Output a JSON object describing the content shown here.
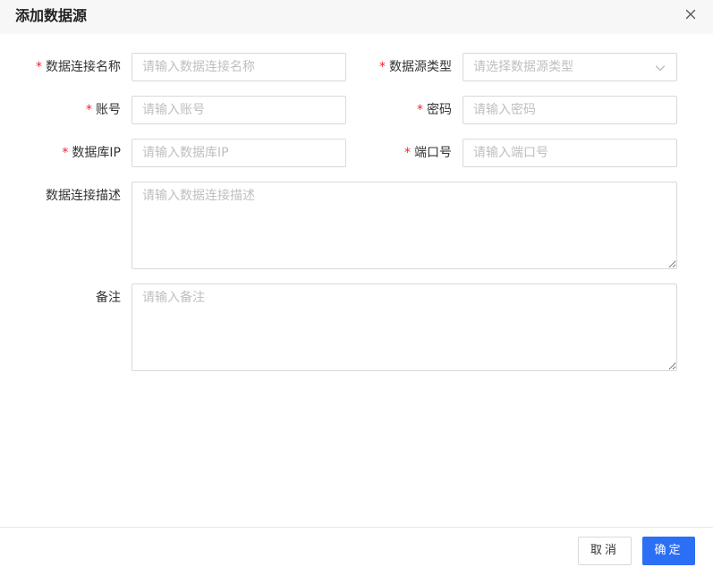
{
  "dialog": {
    "title": "添加数据源",
    "close_icon": "close-icon"
  },
  "form": {
    "connection_name": {
      "required": "*",
      "label": "数据连接名称",
      "placeholder": "请输入数据连接名称"
    },
    "source_type": {
      "required": "*",
      "label": "数据源类型",
      "placeholder": "请选择数据源类型",
      "icon": "chevron-down-icon"
    },
    "account": {
      "required": "*",
      "label": "账号",
      "placeholder": "请输入账号"
    },
    "password": {
      "required": "*",
      "label": "密码",
      "placeholder": "请输入密码"
    },
    "db_ip": {
      "required": "*",
      "label": "数据库IP",
      "placeholder": "请输入数据库IP"
    },
    "port": {
      "required": "*",
      "label": "端口号",
      "placeholder": "请输入端口号"
    },
    "description": {
      "label": "数据连接描述",
      "placeholder": "请输入数据连接描述"
    },
    "remark": {
      "label": "备注",
      "placeholder": "请输入备注"
    }
  },
  "footer": {
    "cancel_label": "取消",
    "ok_label": "确定"
  },
  "colors": {
    "primary": "#2b6ff5",
    "required": "#f5222d",
    "header_bg": "#f7f7f7",
    "border": "#d9d9d9",
    "placeholder": "#bfbfbf"
  }
}
